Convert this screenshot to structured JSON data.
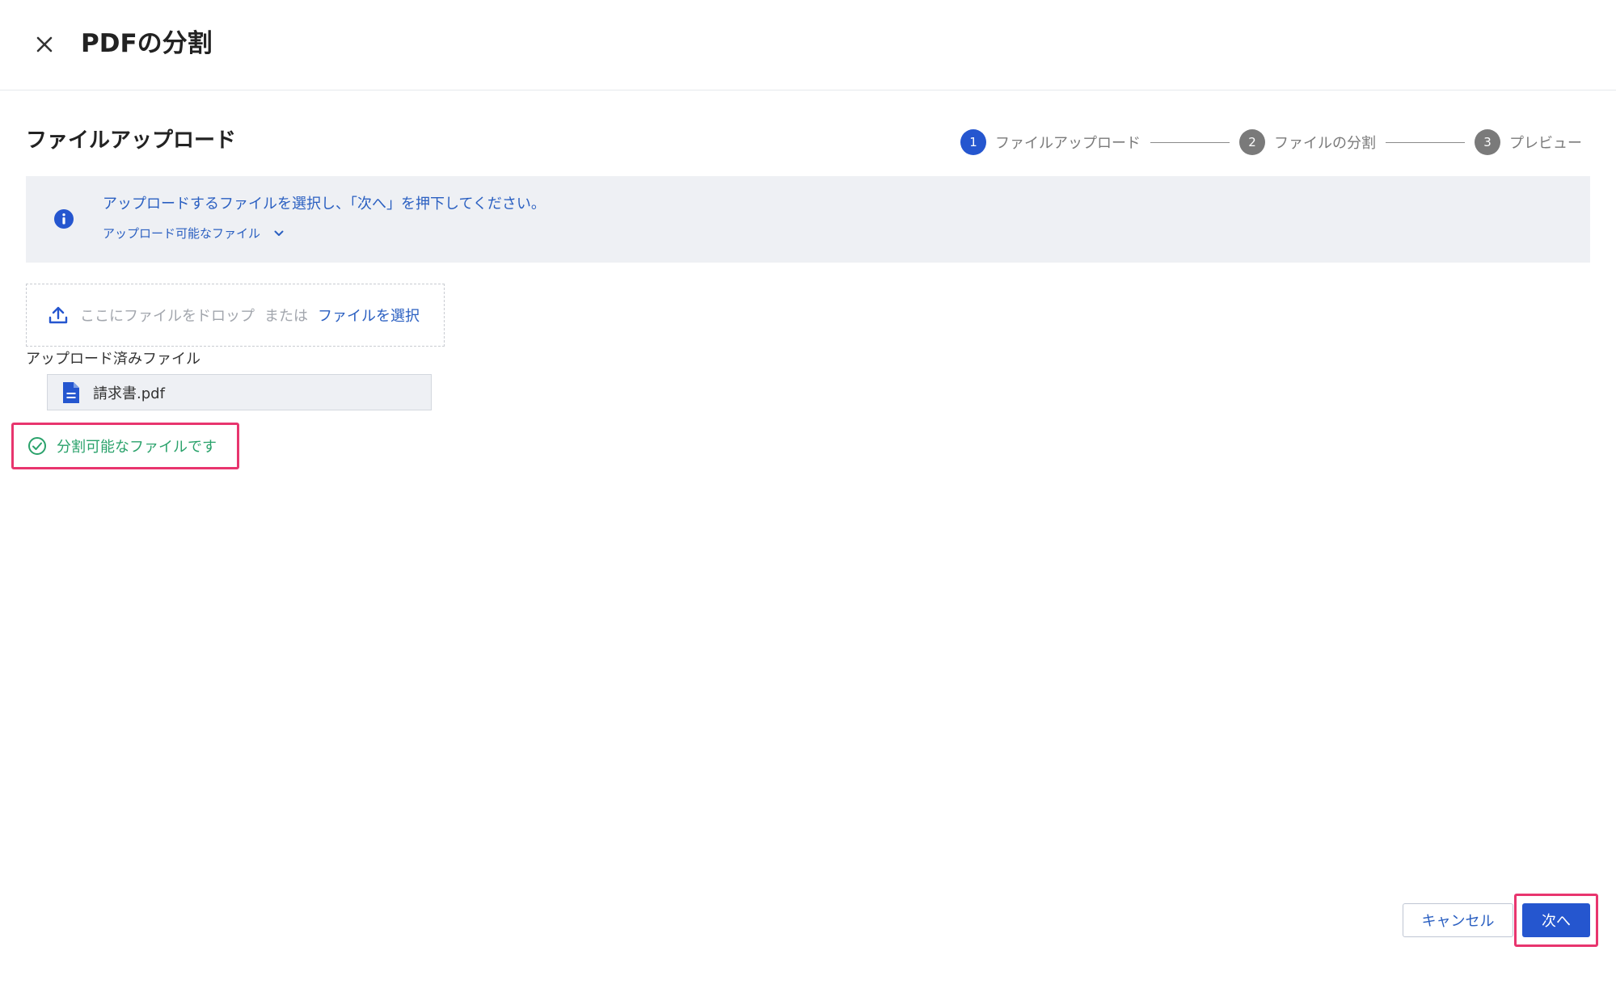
{
  "dialog": {
    "title": "PDFの分割"
  },
  "section": {
    "title": "ファイルアップロード"
  },
  "stepper": {
    "steps": [
      {
        "number": "1",
        "label": "ファイルアップロード",
        "color": "#2556cf"
      },
      {
        "number": "2",
        "label": "ファイルの分割",
        "color": "#7a7a7a"
      },
      {
        "number": "3",
        "label": "プレビュー",
        "color": "#7a7a7a"
      }
    ],
    "current_step": 1
  },
  "info_banner": {
    "icon": "info-icon",
    "message": "アップロードするファイルを選択し、「次へ」を押下してください。",
    "expand_label": "アップロード可能なファイル"
  },
  "dropzone": {
    "icon": "upload-icon",
    "drop_text": "ここにファイルをドロップ",
    "or_text": "または",
    "select_link": "ファイルを選択"
  },
  "uploaded": {
    "label": "アップロード済みファイル",
    "files": [
      {
        "icon": "document-icon",
        "name": "請求書.pdf"
      }
    ]
  },
  "status": {
    "icon": "check-circle-icon",
    "text": "分割可能なファイルです",
    "color": "#2aa26b"
  },
  "footer": {
    "cancel_label": "キャンセル",
    "next_label": "次へ"
  },
  "colors": {
    "accent": "#2556cf",
    "link": "#2a5fc1",
    "highlight": "#e8356e",
    "banner_bg": "#eef0f4"
  }
}
